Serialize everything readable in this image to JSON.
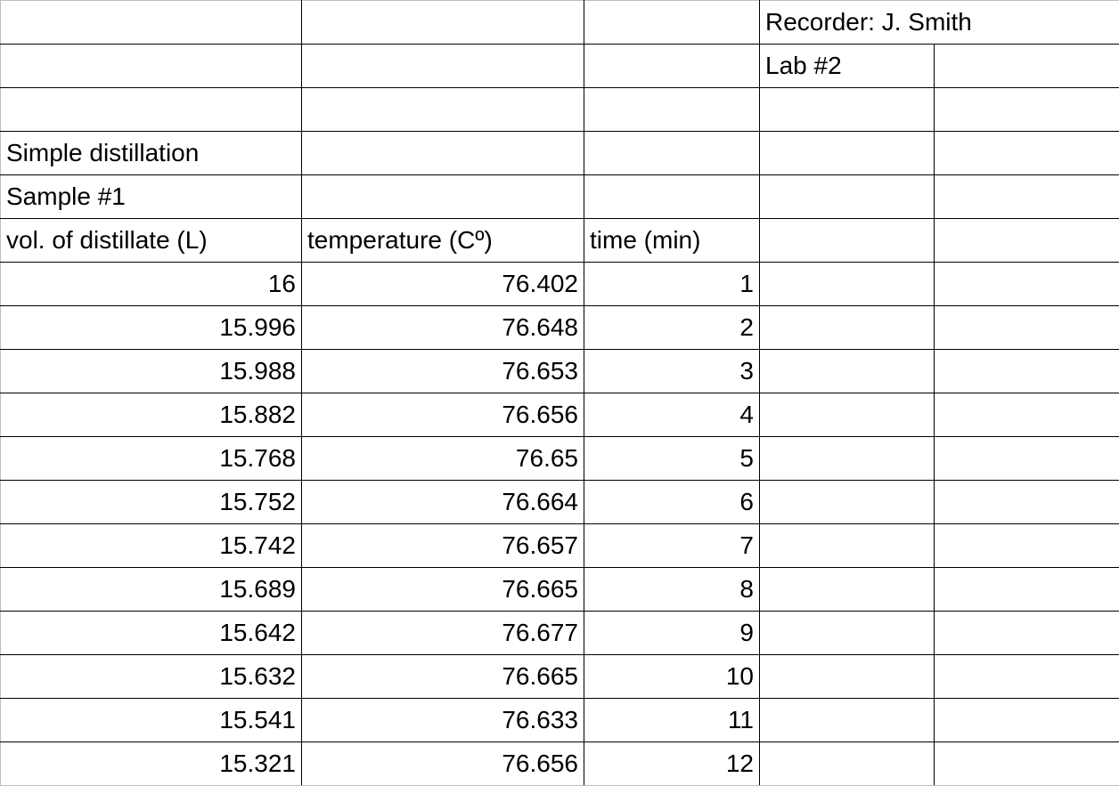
{
  "header": {
    "recorder": "Recorder: J. Smith",
    "lab": "Lab #2"
  },
  "meta": {
    "experiment": "Simple distillation",
    "sample": "Sample #1"
  },
  "columns": {
    "vol": "vol. of distillate (L)",
    "temp": "temperature (Cº)",
    "time": "time (min)"
  },
  "rows": [
    {
      "vol": "16",
      "temp": "76.402",
      "time": "1"
    },
    {
      "vol": "15.996",
      "temp": "76.648",
      "time": "2"
    },
    {
      "vol": "15.988",
      "temp": "76.653",
      "time": "3"
    },
    {
      "vol": "15.882",
      "temp": "76.656",
      "time": "4"
    },
    {
      "vol": "15.768",
      "temp": "76.65",
      "time": "5"
    },
    {
      "vol": "15.752",
      "temp": "76.664",
      "time": "6"
    },
    {
      "vol": "15.742",
      "temp": "76.657",
      "time": "7"
    },
    {
      "vol": "15.689",
      "temp": "76.665",
      "time": "8"
    },
    {
      "vol": "15.642",
      "temp": "76.677",
      "time": "9"
    },
    {
      "vol": "15.632",
      "temp": "76.665",
      "time": "10"
    },
    {
      "vol": "15.541",
      "temp": "76.633",
      "time": "11"
    },
    {
      "vol": "15.321",
      "temp": "76.656",
      "time": "12"
    }
  ]
}
